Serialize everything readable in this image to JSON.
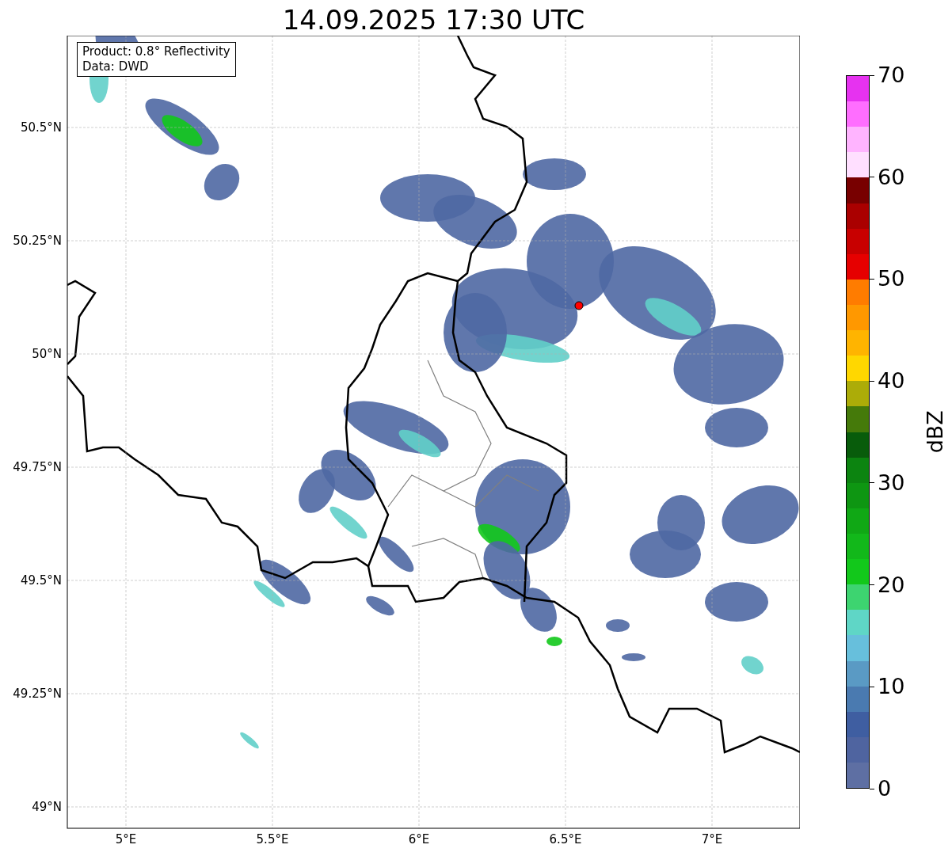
{
  "title": "14.09.2025 17:30 UTC",
  "info_box": {
    "lines": [
      "Product: 0.8° Reflectivity",
      "Data: DWD"
    ]
  },
  "map": {
    "x_ticks": [
      "5°E",
      "5.5°E",
      "6°E",
      "6.5°E",
      "7°E"
    ],
    "y_ticks": [
      "50.5°N",
      "50.25°N",
      "50°N",
      "49.75°N",
      "49.5°N",
      "49.25°N",
      "49°N"
    ]
  },
  "colorbar": {
    "label": "dBZ",
    "ticks": [
      "70",
      "60",
      "50",
      "40",
      "30",
      "20",
      "10",
      "0"
    ],
    "bins": [
      {
        "color": "#e632f0"
      },
      {
        "color": "#ff6eff"
      },
      {
        "color": "#ffb4ff"
      },
      {
        "color": "#ffdfff"
      },
      {
        "color": "#780000"
      },
      {
        "color": "#aa0000"
      },
      {
        "color": "#c80000"
      },
      {
        "color": "#e60000"
      },
      {
        "color": "#ff7c00"
      },
      {
        "color": "#ff9800"
      },
      {
        "color": "#ffb400"
      },
      {
        "color": "#ffd700"
      },
      {
        "color": "#acac08"
      },
      {
        "color": "#457a0a"
      },
      {
        "color": "#085c0b"
      },
      {
        "color": "#0c8410"
      },
      {
        "color": "#0e9612"
      },
      {
        "color": "#10a815"
      },
      {
        "color": "#12b81a"
      },
      {
        "color": "#12c81b"
      },
      {
        "color": "#3dd470"
      },
      {
        "color": "#5fd6c6"
      },
      {
        "color": "#67bfdc"
      },
      {
        "color": "#5a9ac4"
      },
      {
        "color": "#4a7ab0"
      },
      {
        "color": "#3f5ea1"
      },
      {
        "color": "#4f64a0"
      },
      {
        "color": "#5e6fa3"
      }
    ]
  }
}
